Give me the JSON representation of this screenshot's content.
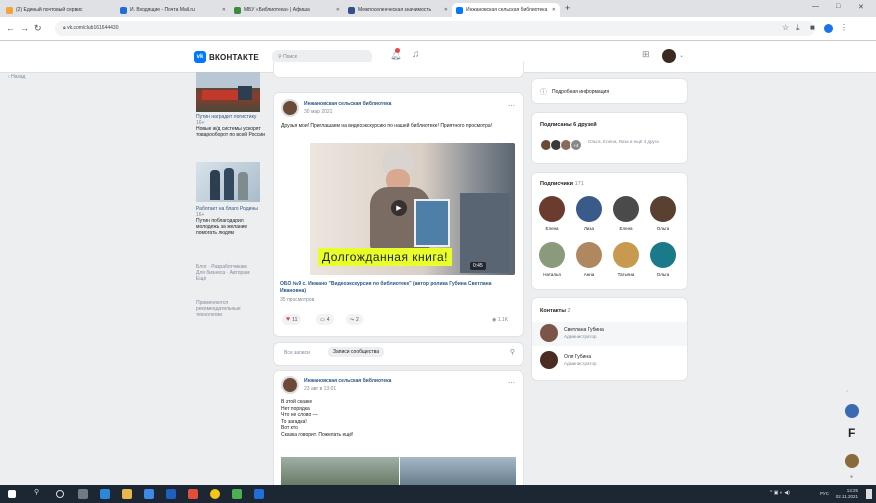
{
  "browser": {
    "tabs": [
      {
        "label": "(2) Единый почтовый сервис",
        "color": "#f2a33a"
      },
      {
        "label": "И. Входящие - Почта Mail.ru",
        "color": "#1e6fd9"
      },
      {
        "label": "МБУ «Библиотека» | Афиша",
        "color": "#3c8a3e"
      },
      {
        "label": "Межпоселенческая значимость",
        "color": "#334f88"
      },
      {
        "label": "Инжановская сельская библиотека",
        "color": "#0077ff"
      }
    ],
    "new_tab": "+",
    "url": "vk.com/club161644430",
    "window_controls": [
      "—",
      "□",
      "✕"
    ]
  },
  "vk": {
    "logo_text": "ВКОНТАКТЕ",
    "logo_mark": "vk",
    "search_placeholder": "Поиск"
  },
  "left": {
    "back_label": "Назад",
    "ads": [
      {
        "title": "Путин наградит логистику",
        "sub": "16+",
        "text": "Новые ж/д системы ускорят товарооборот по всей России"
      },
      {
        "title": "Работает на благо Родины",
        "sub": "16+",
        "text": "Путин поблагодарил молодежь за желание помогать людям"
      }
    ],
    "links": [
      "Блог · Разработчикам",
      "Для бизнеса · Авторам",
      "Ещё"
    ],
    "footer": "Применяются рекомендательные технологии"
  },
  "post1": {
    "author": "Инжановская сельская библиотека",
    "date": "30 мар 2021",
    "text": "Друзья мои! Приглашаем на видеоэкскурсию по нашей библиотеке! Приятного просмотра!",
    "video_caption": "Долгожданная книга!",
    "video_duration": "0:45",
    "video_title": "ОБО №9 с. Инжано \"Видеоэкскурсия по библиотеке\" (автор ролика Губина Светлана Ивановна)",
    "video_views": "35 просмотров",
    "likes": "11",
    "comments": "4",
    "reposts": "2",
    "views": "1.1K"
  },
  "feed_tabs": {
    "all": "Все записи",
    "community": "Записи сообщества"
  },
  "post2": {
    "author": "Инжановская сельская библиотека",
    "date": "23 авг в 13:01",
    "lines": [
      "В этой сказке",
      "Нет порядка",
      "Что не слово —",
      "То загадка!",
      "Вот кто",
      "Сказка говорит. Пожелать ещё!"
    ]
  },
  "right": {
    "info_label": "Подробная информация",
    "friends_title": "Подписаны 6 друзей",
    "friends_extra": "+4",
    "friends_text": "Ольга, Елена, Лиза и ещё 3 друга",
    "subs_title": "Подписчики",
    "subs_count": "171",
    "subscribers": [
      {
        "name": "Елена",
        "color": "#6a3b2e"
      },
      {
        "name": "Лиза",
        "color": "#3a5a8a"
      },
      {
        "name": "Елена",
        "color": "#4a4a4a"
      },
      {
        "name": "Ольга",
        "color": "#5a4030"
      },
      {
        "name": "Наталья",
        "color": "#8a9a7a"
      },
      {
        "name": "Анна",
        "color": "#b08860"
      },
      {
        "name": "Татьяна",
        "color": "#c89a50"
      },
      {
        "name": "Ольга",
        "color": "#1a7a8a"
      }
    ],
    "contacts_title": "Контакты",
    "contacts_count": "2",
    "contacts": [
      {
        "name": "Светлана Губина",
        "role": "Администратор"
      },
      {
        "name": "Оля Губина",
        "role": "Администратор"
      }
    ]
  },
  "taskbar": {
    "time": "13:25",
    "date": "02.11.2021",
    "lang": "РУС"
  }
}
